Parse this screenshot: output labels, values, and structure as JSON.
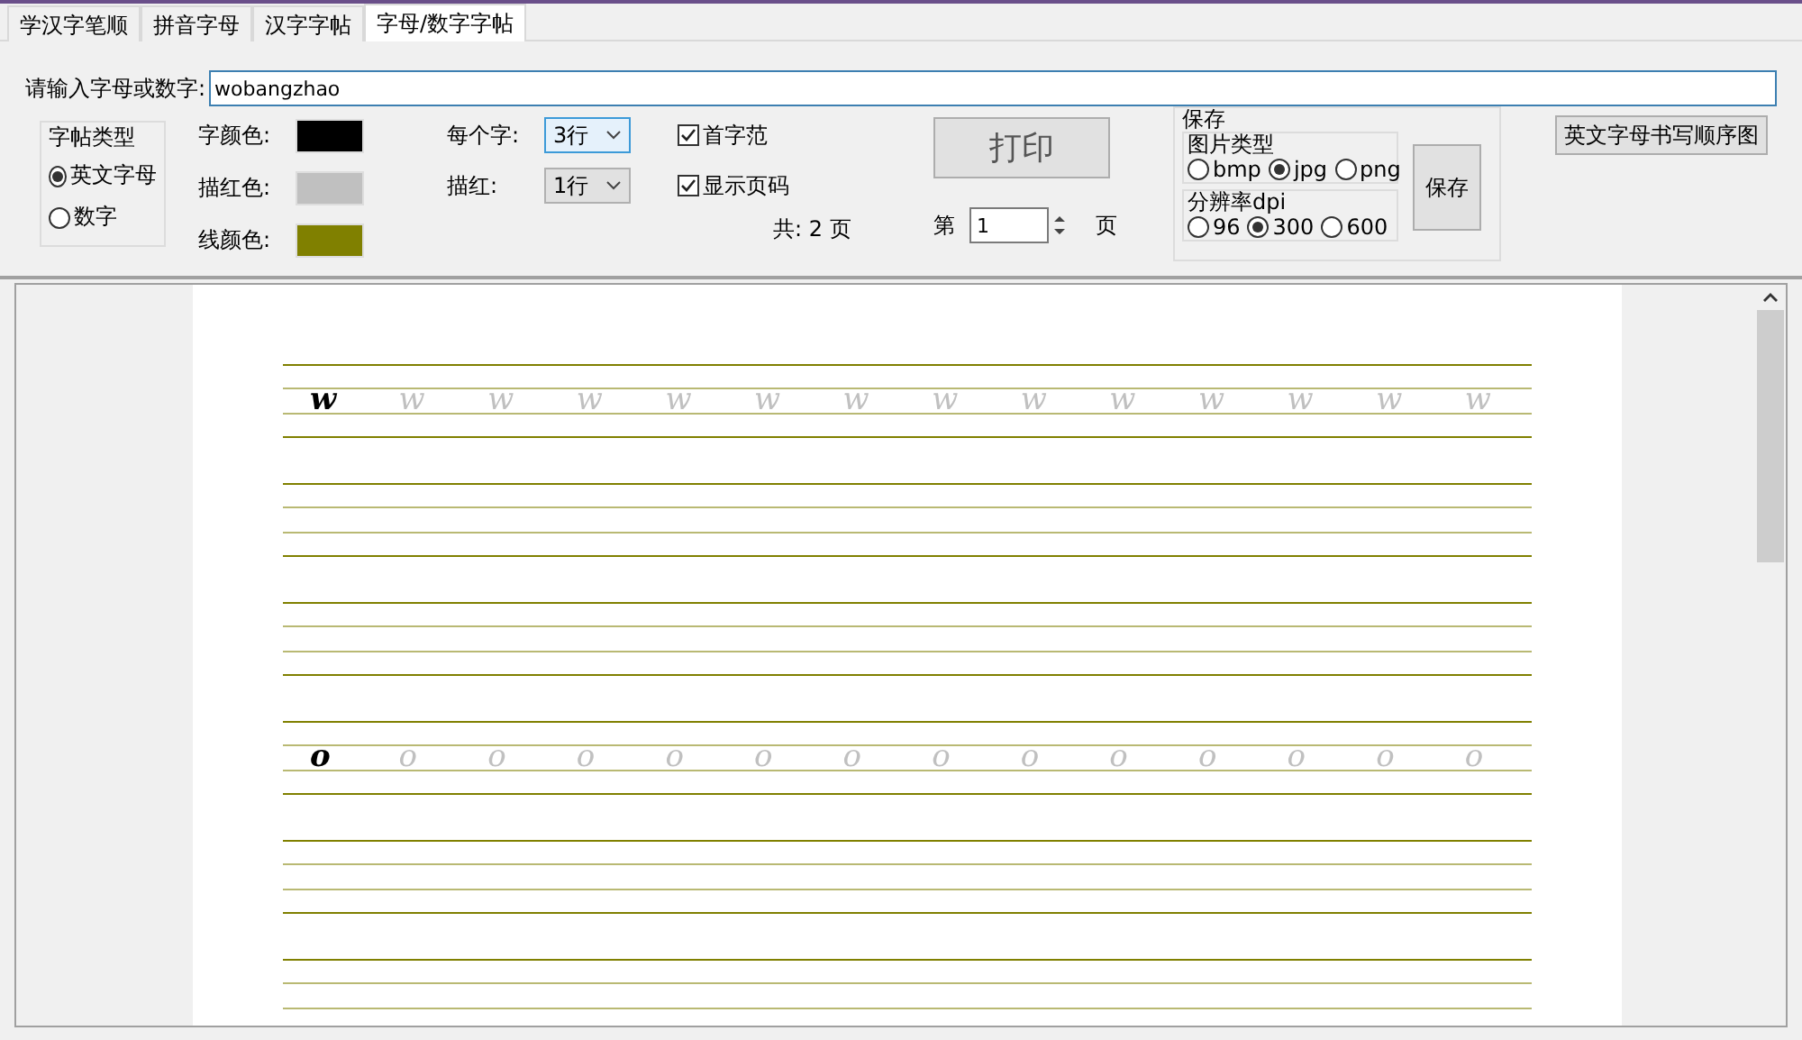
{
  "tabs": [
    {
      "label": "学汉字笔顺",
      "selected": false
    },
    {
      "label": "拼音字母",
      "selected": false
    },
    {
      "label": "汉字字帖",
      "selected": false
    },
    {
      "label": "字母/数字字帖",
      "selected": true
    }
  ],
  "input": {
    "label": "请输入字母或数字:",
    "value": "wobangzhao"
  },
  "copybook_type": {
    "title": "字帖类型",
    "options": [
      {
        "label": "英文字母",
        "selected": true
      },
      {
        "label": "数字",
        "selected": false
      }
    ]
  },
  "colors": [
    {
      "label": "字颜色:",
      "color": "#000000"
    },
    {
      "label": "描红色:",
      "color": "#c0c0c0"
    },
    {
      "label": "线颜色:",
      "color": "#808000"
    }
  ],
  "selects": [
    {
      "label": "每个字:",
      "value": "3行",
      "focused": true
    },
    {
      "label": "描红:",
      "value": "1行",
      "focused": false
    }
  ],
  "checkboxes": [
    {
      "label": "首字范",
      "checked": true
    },
    {
      "label": "显示页码",
      "checked": true
    }
  ],
  "total_pages": "共: 2 页",
  "print_button": "打印",
  "page_picker": {
    "prefix": "第",
    "value": "1",
    "suffix": "页"
  },
  "save": {
    "title": "保存",
    "image_type": {
      "title": "图片类型",
      "options": [
        {
          "label": "bmp",
          "selected": false
        },
        {
          "label": "jpg",
          "selected": true
        },
        {
          "label": "png",
          "selected": false
        }
      ]
    },
    "dpi": {
      "title": "分辨率dpi",
      "options": [
        {
          "label": "96",
          "selected": false
        },
        {
          "label": "300",
          "selected": true
        },
        {
          "label": "600",
          "selected": false
        }
      ]
    },
    "button": "保存"
  },
  "order_button": "英文字母书写顺序图",
  "practice_rows": [
    {
      "kind": "letter",
      "model": "w",
      "traces": [
        "w",
        "w",
        "w",
        "w",
        "w",
        "w",
        "w",
        "w",
        "w",
        "w",
        "w",
        "w",
        "w"
      ]
    },
    {
      "kind": "blank"
    },
    {
      "kind": "blank"
    },
    {
      "kind": "letter",
      "model": "o",
      "traces": [
        "o",
        "o",
        "o",
        "o",
        "o",
        "o",
        "o",
        "o",
        "o",
        "o",
        "o",
        "o",
        "o"
      ]
    },
    {
      "kind": "blank"
    },
    {
      "kind": "blank"
    }
  ]
}
